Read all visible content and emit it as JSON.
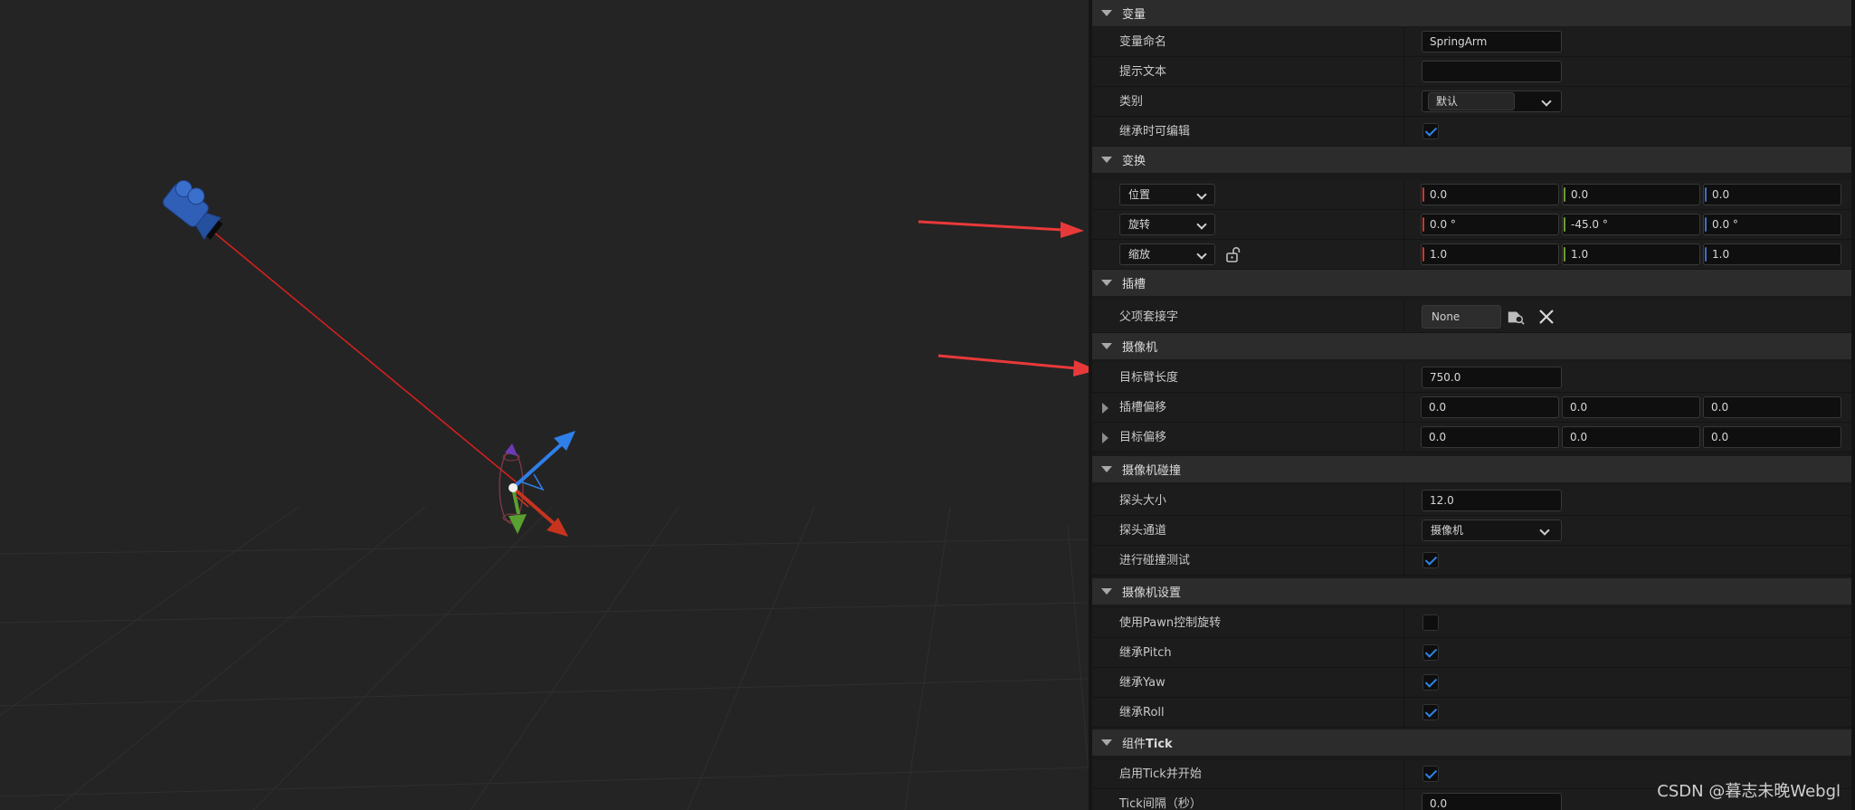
{
  "sections": {
    "variable": "变量",
    "transform": "变换",
    "sockets": "插槽",
    "camera": "摄像机",
    "camera_collision": "摄像机碰撞",
    "camera_settings": "摄像机设置",
    "component_tick_prefix": "组件",
    "component_tick_bold": "Tick"
  },
  "variable": {
    "name_label": "变量命名",
    "name_value": "SpringArm",
    "tooltip_label": "提示文本",
    "tooltip_value": "",
    "category_label": "类别",
    "category_value": "默认",
    "editable_label": "继承时可编辑",
    "editable_checked": true
  },
  "transform": {
    "location_mode": "位置",
    "location": [
      "0.0",
      "0.0",
      "0.0"
    ],
    "rotation_mode": "旋转",
    "rotation": [
      "0.0 °",
      "-45.0 °",
      "0.0 °"
    ],
    "scale_mode": "缩放",
    "scale": [
      "1.0",
      "1.0",
      "1.0"
    ]
  },
  "sockets": {
    "parent_socket_label": "父项套接字",
    "parent_socket_value": "None"
  },
  "camera": {
    "arm_length_label": "目标臂长度",
    "arm_length_value": "750.0",
    "socket_offset_label": "插槽偏移",
    "socket_offset": [
      "0.0",
      "0.0",
      "0.0"
    ],
    "target_offset_label": "目标偏移",
    "target_offset": [
      "0.0",
      "0.0",
      "0.0"
    ]
  },
  "camera_collision": {
    "probe_size_label": "探头大小",
    "probe_size_value": "12.0",
    "probe_channel_label": "探头通道",
    "probe_channel_value": "摄像机",
    "do_collision_label": "进行碰撞测试",
    "do_collision_checked": true
  },
  "camera_settings": {
    "use_pawn_rotation_label": "使用Pawn控制旋转",
    "use_pawn_rotation_checked": false,
    "inherit_pitch_label": "继承Pitch",
    "inherit_pitch_checked": true,
    "inherit_yaw_label": "继承Yaw",
    "inherit_yaw_checked": true,
    "inherit_roll_label": "继承Roll",
    "inherit_roll_checked": true
  },
  "component_tick": {
    "start_label": "启用Tick并开始",
    "start_checked": true,
    "interval_label": "Tick间隔（秒）",
    "interval_value": "0.0"
  },
  "watermark": "CSDN @暮志未晚Webgl",
  "colors": {
    "accent_blue": "#2e84e6",
    "annotation_red": "#e8393a",
    "axis_x": "#c33a2e",
    "axis_y": "#6c9c32",
    "axis_z": "#3a6fc8"
  }
}
